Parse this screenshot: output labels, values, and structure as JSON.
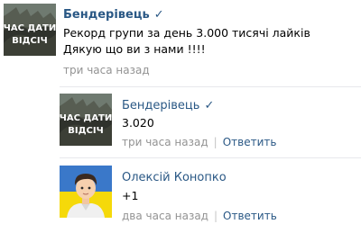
{
  "post": {
    "author": "Бендерівець",
    "verified_icon": "checkmark-icon",
    "text_line1": "Рекорд групи за день 3.000 тисячі лайків",
    "text_line2": "Дякую що ви з нами !!!!",
    "time": "три часа назад",
    "avatar_caption_top": "ЧАС ДАТИ",
    "avatar_caption_bottom": "ВІДСІЧ"
  },
  "replies": [
    {
      "author": "Бендерівець",
      "text": "3.020",
      "time": "три часа назад",
      "reply_label": "Ответить",
      "avatar_caption_top": "ЧАС ДАТИ",
      "avatar_caption_bottom": "ВІДСІЧ"
    },
    {
      "author": "Олексій Конопко",
      "text": "+1",
      "time": "два часа назад",
      "reply_label": "Ответить"
    }
  ],
  "colors": {
    "link": "#2a5885",
    "meta": "#939393",
    "divider": "#e7e8ec",
    "flag_blue": "#3a78c9",
    "flag_yellow": "#f5d90a"
  }
}
